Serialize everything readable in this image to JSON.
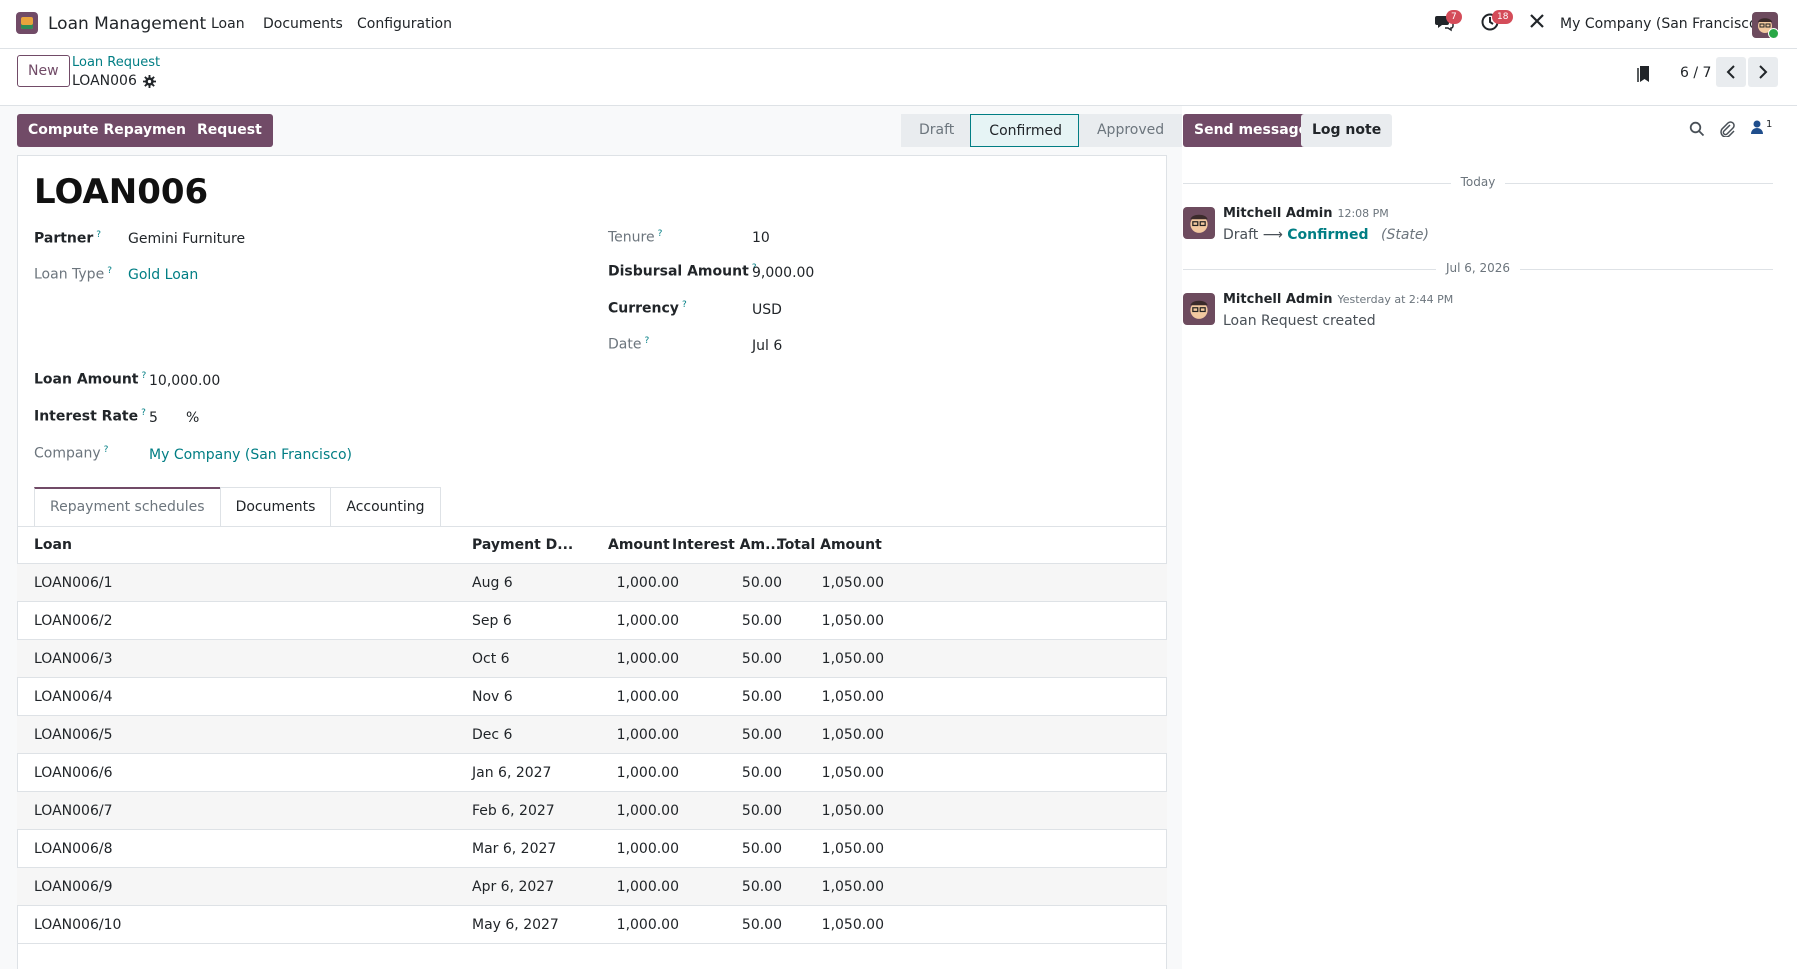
{
  "navbar": {
    "app_name": "Loan Management",
    "menus": [
      "Loan",
      "Documents",
      "Configuration"
    ],
    "messages_badge": "7",
    "activities_badge": "18",
    "company": "My Company (San Francisco)"
  },
  "control": {
    "new_label": "New",
    "breadcrumb_parent": "Loan Request",
    "breadcrumb_current": "LOAN006",
    "pager": "6 / 7"
  },
  "actions": {
    "compute_label": "Compute Repayments",
    "request_label": "Request"
  },
  "statusbar": [
    "Draft",
    "Confirmed",
    "Approved"
  ],
  "form": {
    "title": "LOAN006",
    "partner_label": "Partner",
    "partner": "Gemini Furniture",
    "loan_type_label": "Loan Type",
    "loan_type": "Gold Loan",
    "tenure_label": "Tenure",
    "tenure": "10",
    "disbursal_label": "Disbursal Amount",
    "disbursal": "9,000.00",
    "currency_label": "Currency",
    "currency": "USD",
    "date_label": "Date",
    "date": "Jul 6",
    "loan_amount_label": "Loan Amount",
    "loan_amount": "10,000.00",
    "interest_label": "Interest Rate",
    "interest": "5",
    "interest_unit": "%",
    "company_label": "Company",
    "company": "My Company (San Francisco)",
    "help_mark": "?"
  },
  "tabs": [
    "Repayment schedules",
    "Documents",
    "Accounting"
  ],
  "table": {
    "headers": [
      "Loan",
      "Payment D...",
      "Amount",
      "Interest Am...",
      "Total Amount"
    ],
    "rows": [
      [
        "LOAN006/1",
        "Aug 6",
        "1,000.00",
        "50.00",
        "1,050.00"
      ],
      [
        "LOAN006/2",
        "Sep 6",
        "1,000.00",
        "50.00",
        "1,050.00"
      ],
      [
        "LOAN006/3",
        "Oct 6",
        "1,000.00",
        "50.00",
        "1,050.00"
      ],
      [
        "LOAN006/4",
        "Nov 6",
        "1,000.00",
        "50.00",
        "1,050.00"
      ],
      [
        "LOAN006/5",
        "Dec 6",
        "1,000.00",
        "50.00",
        "1,050.00"
      ],
      [
        "LOAN006/6",
        "Jan 6, 2027",
        "1,000.00",
        "50.00",
        "1,050.00"
      ],
      [
        "LOAN006/7",
        "Feb 6, 2027",
        "1,000.00",
        "50.00",
        "1,050.00"
      ],
      [
        "LOAN006/8",
        "Mar 6, 2027",
        "1,000.00",
        "50.00",
        "1,050.00"
      ],
      [
        "LOAN006/9",
        "Apr 6, 2027",
        "1,000.00",
        "50.00",
        "1,050.00"
      ],
      [
        "LOAN006/10",
        "May 6, 2027",
        "1,000.00",
        "50.00",
        "1,050.00"
      ]
    ]
  },
  "chatter": {
    "send_label": "Send message",
    "log_label": "Log note",
    "followers_count": "1",
    "sep_today": "Today",
    "sep_date": "Jul 6, 2026",
    "msg1_author": "Mitchell Admin",
    "msg1_time": "12:08 PM",
    "msg1_from": "Draft",
    "msg1_arrow": "⟶",
    "msg1_to": "Confirmed",
    "msg1_field": "(State)",
    "msg2_author": "Mitchell Admin",
    "msg2_time": "Yesterday at 2:44 PM",
    "msg2_body": "Loan Request created"
  },
  "colors": {
    "brand": "#714b67",
    "link": "#017e84",
    "badge": "#d44c59"
  }
}
